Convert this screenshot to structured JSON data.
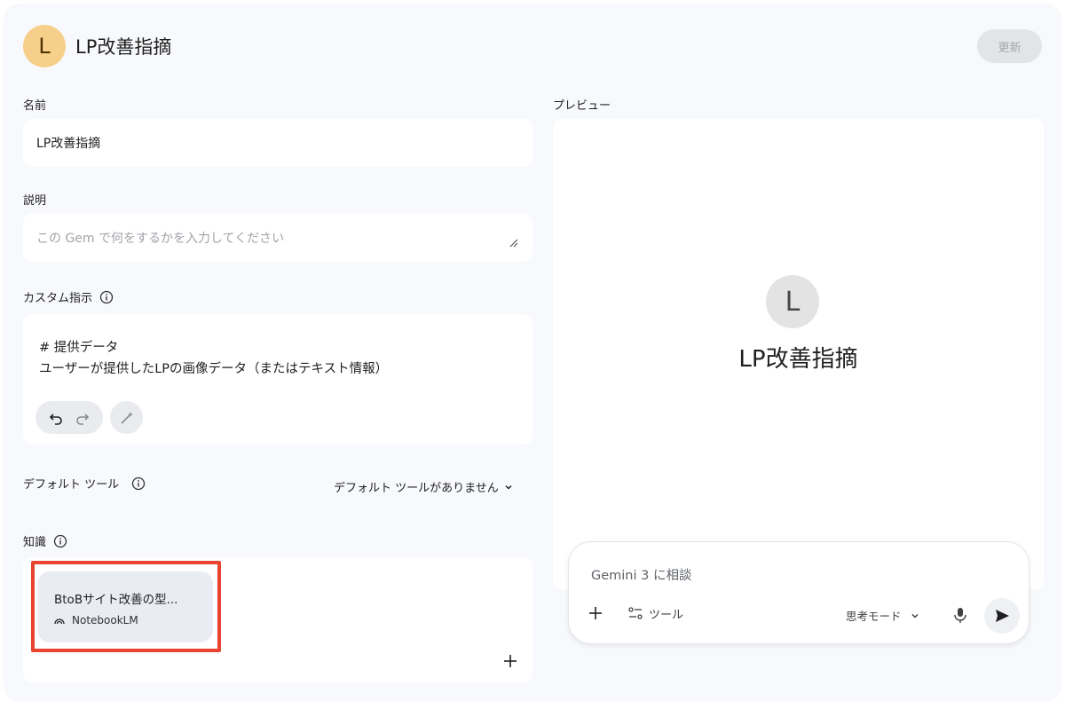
{
  "header": {
    "avatar_letter": "L",
    "title": "LP改善指摘",
    "update_button": "更新"
  },
  "form": {
    "name_label": "名前",
    "name_value": "LP改善指摘",
    "description_label": "説明",
    "description_placeholder": "この Gem で何をするかを入力してください",
    "custom_instructions_label": "カスタム指示",
    "custom_instructions_lines": [
      "# 提供データ",
      "ユーザーが提供したLPの画像データ（またはテキスト情報）"
    ],
    "default_tools_label": "デフォルト ツール",
    "default_tools_value": "デフォルト ツールがありません",
    "knowledge_label": "知識",
    "knowledge_items": [
      {
        "title": "BtoBサイト改善の型...",
        "source": "NotebookLM"
      }
    ]
  },
  "preview": {
    "label": "プレビュー",
    "avatar_letter": "L",
    "title": "LP改善指摘",
    "chat_placeholder": "Gemini 3 に相談",
    "tools_label": "ツール",
    "mode_label": "思考モード"
  },
  "colors": {
    "avatar_bg": "#f6cf8a",
    "highlight_border": "#e8442f",
    "page_bg": "#f8f9fc"
  }
}
